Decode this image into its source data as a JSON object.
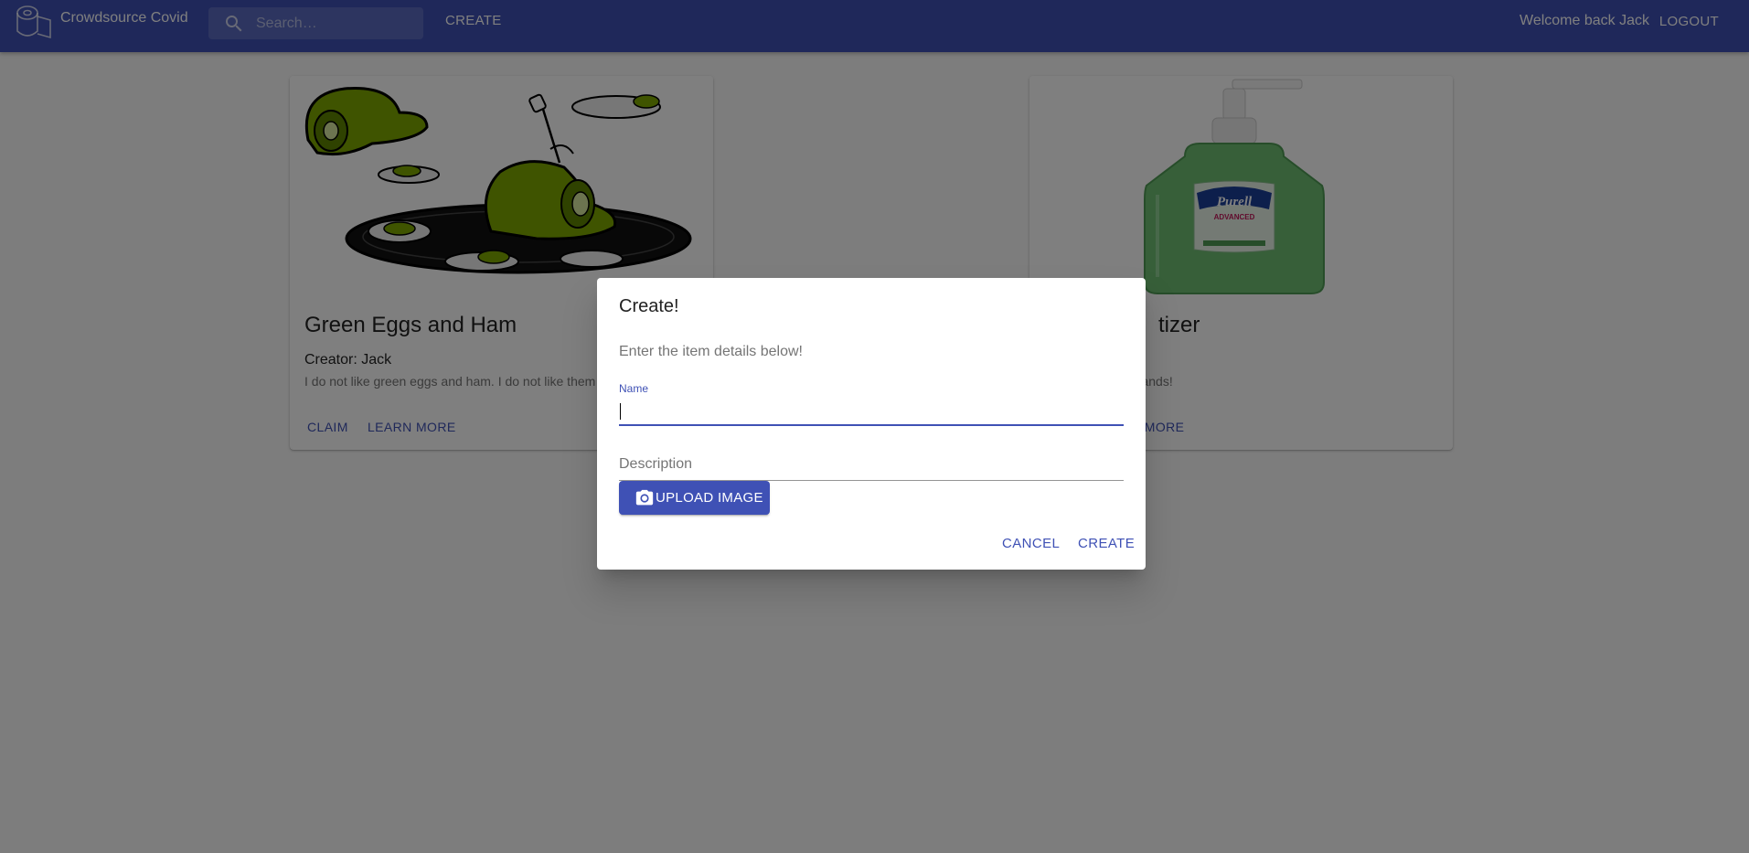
{
  "appbar": {
    "brand_title": "Crowdsource Covid",
    "search_placeholder": "Search…",
    "create_label": "CREATE",
    "welcome_text": "Welcome back Jack",
    "logout_label": "LOGOUT",
    "color": "#3f51b5"
  },
  "cards": [
    {
      "title": "Green Eggs and Ham",
      "creator": "Creator: Jack",
      "description": "I do not like green eggs and ham. I do not like them",
      "image_icon": "green-eggs-and-ham-illustration",
      "claim_label": "CLAIM",
      "learn_more_label": "LEARN MORE"
    },
    {
      "title_visible": "tizer",
      "description_visible": "g hands!",
      "image_icon": "hand-sanitizer-bottle",
      "bottle_brand": "Purell",
      "bottle_subtitle": "ADVANCED",
      "learn_more_visible": "N MORE"
    }
  ],
  "dialog": {
    "title": "Create!",
    "text": "Enter the item details below!",
    "name_label": "Name",
    "name_value": "",
    "description_placeholder": "Description",
    "upload_label": "UPLOAD IMAGE",
    "cancel_label": "CANCEL",
    "create_label": "CREATE"
  }
}
